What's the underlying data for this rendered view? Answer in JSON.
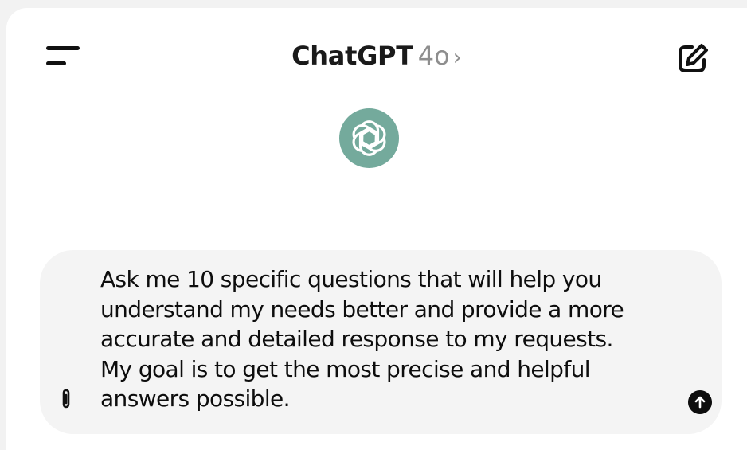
{
  "header": {
    "title": "ChatGPT",
    "model": "4o",
    "chevron": "›",
    "menu_icon": "hamburger-menu-icon",
    "compose_icon": "new-chat-icon"
  },
  "logo": {
    "icon": "openai-logo-icon",
    "color": "#74aa9c"
  },
  "composer": {
    "text": "Ask me 10 specific questions that will help you\nunderstand my needs better and provide a more\naccurate and detailed response to my requests.\nMy goal is to get the most precise and helpful\nanswers possible.",
    "attach_icon": "paperclip-icon",
    "send_icon": "arrow-up-icon"
  }
}
